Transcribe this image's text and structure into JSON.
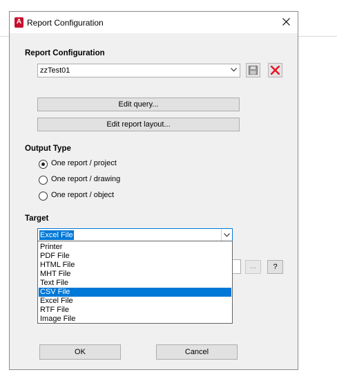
{
  "window": {
    "title": "Report Configuration",
    "icon": "autocad-app-icon",
    "close": "close-icon"
  },
  "report_config": {
    "label": "Report Configuration",
    "selected": "zzTest01",
    "save_icon": "floppy-save-icon",
    "delete_icon": "red-x-delete-icon",
    "edit_query_label": "Edit query...",
    "edit_layout_label": "Edit report layout..."
  },
  "output_type": {
    "label": "Output Type",
    "options": [
      "One report / project",
      "One report / drawing",
      "One report / object"
    ],
    "selected_index": 0
  },
  "target": {
    "label": "Target",
    "selected": "Excel File",
    "options": [
      "Printer",
      "PDF File",
      "HTML File",
      "MHT File",
      "Text File",
      "CSV File",
      "Excel File",
      "RTF File",
      "Image File"
    ],
    "highlighted": "CSV File",
    "browse_label": "...",
    "help_label": "?"
  },
  "footer": {
    "ok_label": "OK",
    "cancel_label": "Cancel"
  },
  "colors": {
    "accent": "#0078d7",
    "delete_red": "#e81123",
    "app_icon_red": "#c8102e"
  }
}
